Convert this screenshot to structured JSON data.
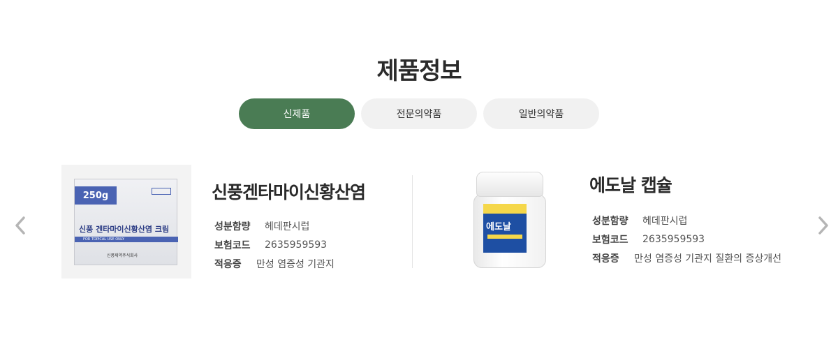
{
  "section": {
    "title": "제품정보"
  },
  "tabs": [
    {
      "label": "신제품",
      "active": true
    },
    {
      "label": "전문의약품",
      "active": false
    },
    {
      "label": "일반의약품",
      "active": false
    }
  ],
  "products": [
    {
      "name": "신풍겐타마이신황산염",
      "labels": {
        "ingredient": "성분함량",
        "insurance": "보험코드",
        "indication": "적응증"
      },
      "ingredient": "헤데판시럽",
      "insurance_code": "2635959593",
      "indication": "만성 염증성 기관지",
      "package": {
        "weight": "250g",
        "title": "신풍 겐타마이신황산염 크림",
        "subtitle": "FOR TOPICAL USE ONLY",
        "maker": "신풍제약주식회사"
      }
    },
    {
      "name": "에도날 캡슐",
      "labels": {
        "ingredient": "성분함량",
        "insurance": "보험코드",
        "indication": "적응증"
      },
      "ingredient": "헤데판시럽",
      "insurance_code": "2635959593",
      "indication": "만성 염증성 기관지 질환의 증상개선",
      "package": {
        "title": "에도날"
      }
    }
  ],
  "colors": {
    "accent": "#4a7c54",
    "tab_inactive": "#f1f1f1"
  },
  "icons": {
    "prev": "chevron-left-icon",
    "next": "chevron-right-icon"
  }
}
